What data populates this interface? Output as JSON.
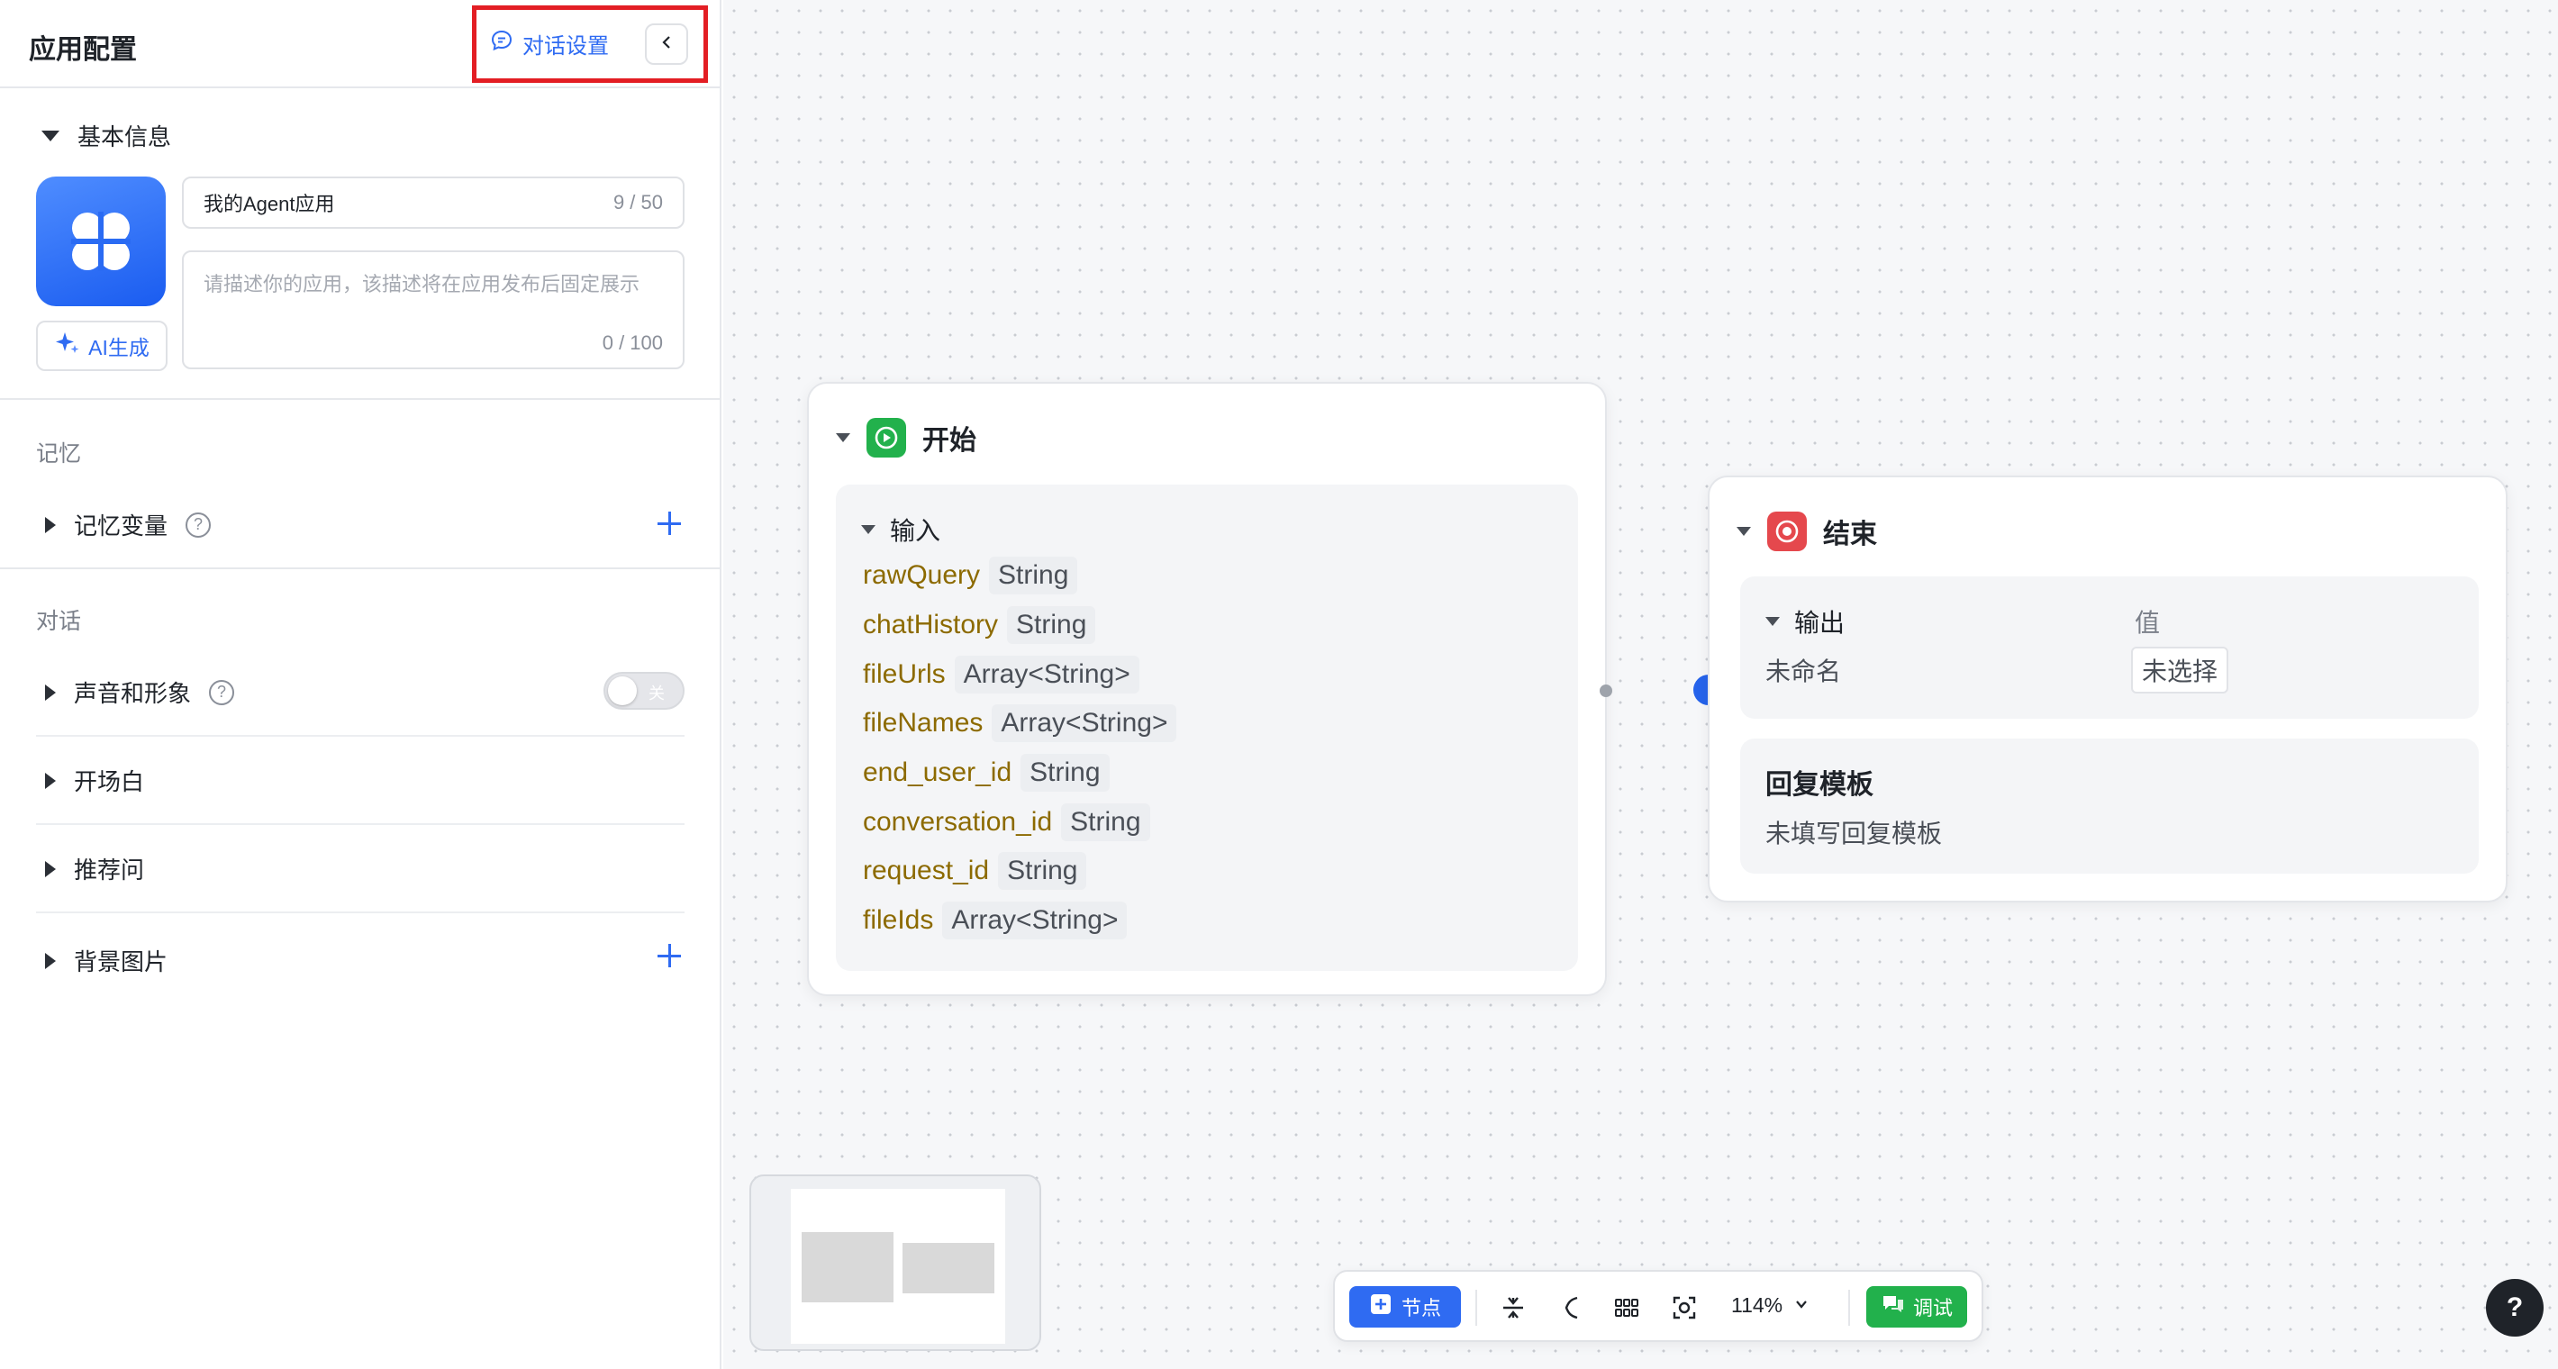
{
  "panel": {
    "title": "应用配置",
    "chat_settings_label": "对话设置",
    "basic_info": {
      "title": "基本信息",
      "app_name": "我的Agent应用",
      "app_name_counter": "9 / 50",
      "description_placeholder": "请描述你的应用，该描述将在应用发布后固定展示",
      "description_counter": "0 / 100",
      "ai_generate_label": "AI生成"
    },
    "memory": {
      "group_label": "记忆",
      "variables_label": "记忆变量"
    },
    "dialog": {
      "group_label": "对话",
      "voice_label": "声音和形象",
      "voice_toggle_text": "关",
      "opening_label": "开场白",
      "suggested_label": "推荐问",
      "background_label": "背景图片"
    }
  },
  "canvas": {
    "start_node": {
      "title": "开始",
      "input_label": "输入",
      "variables": [
        {
          "name": "rawQuery",
          "type": "String"
        },
        {
          "name": "chatHistory",
          "type": "String"
        },
        {
          "name": "fileUrls",
          "type": "Array<String>"
        },
        {
          "name": "fileNames",
          "type": "Array<String>"
        },
        {
          "name": "end_user_id",
          "type": "String"
        },
        {
          "name": "conversation_id",
          "type": "String"
        },
        {
          "name": "request_id",
          "type": "String"
        },
        {
          "name": "fileIds",
          "type": "Array<String>"
        }
      ]
    },
    "end_node": {
      "title": "结束",
      "output_label": "输出",
      "value_header": "值",
      "output_name": "未命名",
      "output_value": "未选择",
      "reply_template_title": "回复模板",
      "reply_template_value": "未填写回复模板"
    }
  },
  "toolbar": {
    "node_button_label": "节点",
    "zoom_label": "114%",
    "debug_button_label": "调试"
  },
  "help_fab_label": "?",
  "colors": {
    "accent": "#2f6bf2",
    "highlight": "#e31e24",
    "start_green": "#22b14c",
    "end_red": "#e5484d",
    "var_name": "#8c6a00"
  }
}
